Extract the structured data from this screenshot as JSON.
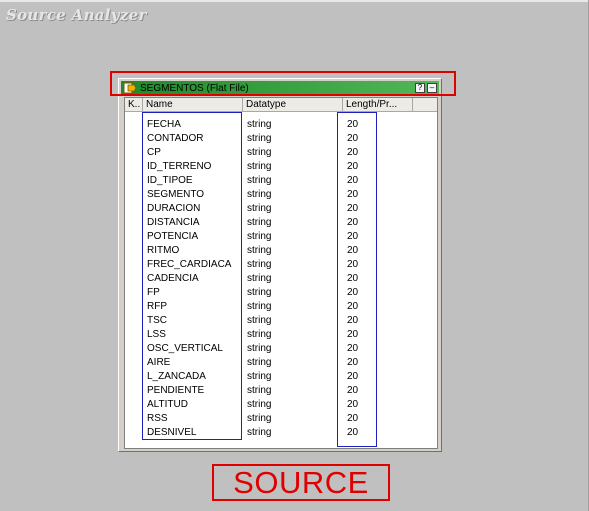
{
  "app": {
    "title": "Source Analyzer"
  },
  "panel": {
    "title": "SEGMENTOS (Flat File)",
    "help_button": "?",
    "minimize_button": "–"
  },
  "grid": {
    "headers": [
      "K..",
      "Name",
      "Datatype",
      "Length/Pr..."
    ],
    "rows": [
      {
        "name": "FECHA",
        "type": "string",
        "length": "20"
      },
      {
        "name": "CONTADOR",
        "type": "string",
        "length": "20"
      },
      {
        "name": "CP",
        "type": "string",
        "length": "20"
      },
      {
        "name": "ID_TERRENO",
        "type": "string",
        "length": "20"
      },
      {
        "name": "ID_TIPOE",
        "type": "string",
        "length": "20"
      },
      {
        "name": "SEGMENTO",
        "type": "string",
        "length": "20"
      },
      {
        "name": "DURACION",
        "type": "string",
        "length": "20"
      },
      {
        "name": "DISTANCIA",
        "type": "string",
        "length": "20"
      },
      {
        "name": "POTENCIA",
        "type": "string",
        "length": "20"
      },
      {
        "name": "RITMO",
        "type": "string",
        "length": "20"
      },
      {
        "name": "FREC_CARDIACA",
        "type": "string",
        "length": "20"
      },
      {
        "name": "CADENCIA",
        "type": "string",
        "length": "20"
      },
      {
        "name": "FP",
        "type": "string",
        "length": "20"
      },
      {
        "name": "RFP",
        "type": "string",
        "length": "20"
      },
      {
        "name": "TSC",
        "type": "string",
        "length": "20"
      },
      {
        "name": "LSS",
        "type": "string",
        "length": "20"
      },
      {
        "name": "OSC_VERTICAL",
        "type": "string",
        "length": "20"
      },
      {
        "name": "AIRE",
        "type": "string",
        "length": "20"
      },
      {
        "name": "L_ZANCADA",
        "type": "string",
        "length": "20"
      },
      {
        "name": "PENDIENTE",
        "type": "string",
        "length": "20"
      },
      {
        "name": "ALTITUD",
        "type": "string",
        "length": "20"
      },
      {
        "name": "RSS",
        "type": "string",
        "length": "20"
      },
      {
        "name": "DESNIVEL",
        "type": "string",
        "length": "20"
      }
    ]
  },
  "annotation": {
    "label": "SOURCE",
    "color": "#e00000",
    "highlight_color": "#2020c0"
  }
}
